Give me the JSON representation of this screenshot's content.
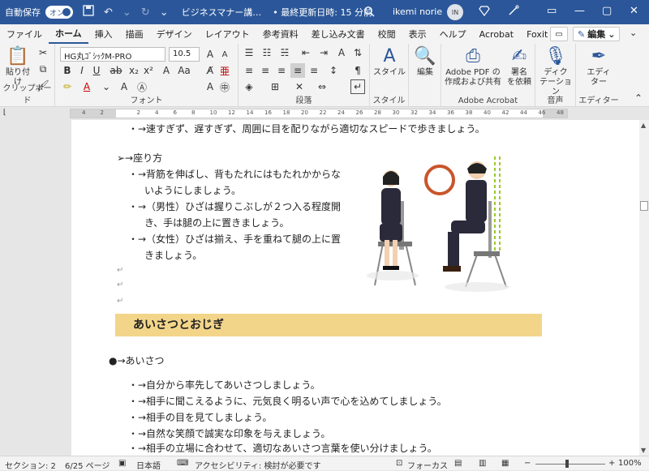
{
  "titlebar": {
    "autosave_label": "自動保存",
    "toggle_label": "オン",
    "doc_title": "ビジネスマナー講…",
    "saved_status": "• 最終更新日時: 15 分前",
    "user_name": "ikemi norie",
    "user_initials": "IN"
  },
  "tabs": [
    "ファイル",
    "ホーム",
    "挿入",
    "描画",
    "デザイン",
    "レイアウト",
    "参考資料",
    "差し込み文書",
    "校閲",
    "表示",
    "ヘルプ",
    "Acrobat",
    "Foxit PDF"
  ],
  "tabs_right": {
    "edit_label": "編集"
  },
  "ribbon": {
    "clipboard": {
      "paste_label": "貼り付け",
      "group_label": "クリップボード"
    },
    "font": {
      "font_name": "HG丸ｺﾞｼｯｸM-PRO",
      "font_size": "10.5",
      "group_label": "フォント"
    },
    "paragraph": {
      "group_label": "段落"
    },
    "style": {
      "style_label": "スタイル",
      "group_label": "スタイル"
    },
    "edit": {
      "edit_label": "編集"
    },
    "acrobat": {
      "pdf_label_1": "Adobe PDF の",
      "pdf_label_2": "作成および共有",
      "sign_label_1": "署名",
      "sign_label_2": "を依頼",
      "group_label": "Adobe Acrobat"
    },
    "voice": {
      "dict_label_1": "ディク",
      "dict_label_2": "テーション",
      "group_label": "音声"
    },
    "editor": {
      "editor_label_1": "エディ",
      "editor_label_2": "ター",
      "group_label": "エディター"
    }
  },
  "ruler_ticks": [
    "4",
    "2",
    "",
    "2",
    "4",
    "6",
    "8",
    "10",
    "12",
    "14",
    "16",
    "18",
    "20",
    "22",
    "24",
    "26",
    "28",
    "30",
    "32",
    "34",
    "36",
    "38",
    "40",
    "42",
    "44",
    "46",
    "48"
  ],
  "document": {
    "top_line": "・→速すぎず、遅すぎず、周囲に目を配りながら適切なスピードで歩きましょう。",
    "sitting_heading": "➢→座り方",
    "sitting_items": [
      "・→背筋を伸ばし、背もたれにはもたれかからな",
      "いようにしましょう。",
      "・→（男性）ひざは握りこぶしが２つ入る程度開",
      "き、手は腿の上に置きましょう。",
      "・→（女性）ひざは揃え、手を重ねて腿の上に置",
      "きましょう。"
    ],
    "section_heading": "あいさつとおじぎ",
    "greeting_heading": "●→あいさつ",
    "greeting_items": [
      "・→自分から率先してあいさつしましょう。",
      "・→相手に聞こえるように、元気良く明るい声で心を込めてしましょう。",
      "・→相手の目を見てしましょう。",
      "・→自然な笑顔で誠実な印象を与えましょう。",
      "・→相手の立場に合わせて、適切なあいさつ言葉を使い分けましょう。"
    ]
  },
  "statusbar": {
    "section": "セクション: 2",
    "page": "6/25 ページ",
    "language": "日本語",
    "accessibility": "アクセシビリティ: 検討が必要です",
    "focus": "フォーカス",
    "zoom": "100%"
  }
}
